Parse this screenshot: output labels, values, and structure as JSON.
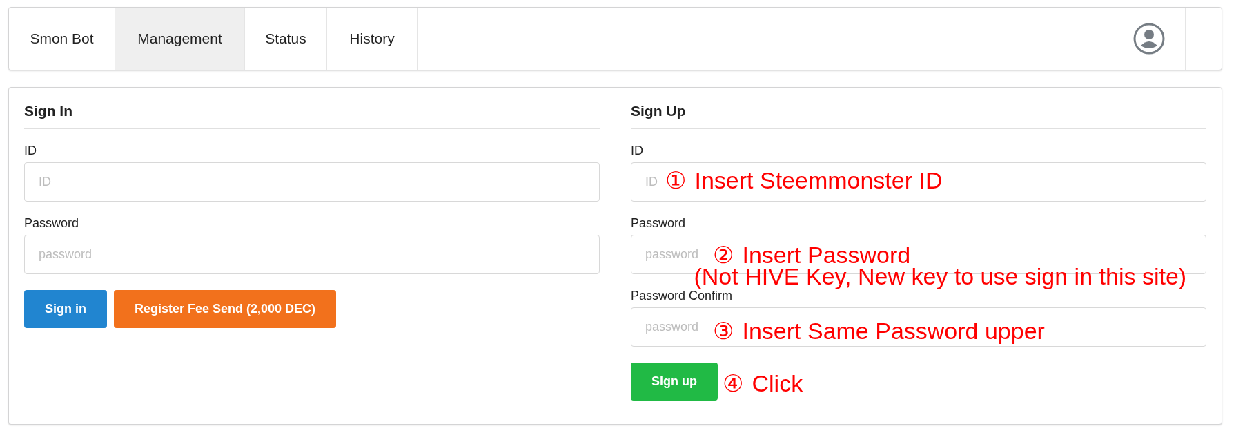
{
  "nav": {
    "tabs": [
      {
        "label": "Smon Bot",
        "selected": false
      },
      {
        "label": "Management",
        "selected": true
      },
      {
        "label": "Status",
        "selected": false
      },
      {
        "label": "History",
        "selected": false
      }
    ]
  },
  "sign_in": {
    "title": "Sign In",
    "fields": [
      {
        "label": "ID",
        "placeholder": "ID"
      },
      {
        "label": "Password",
        "placeholder": "password"
      }
    ],
    "buttons": [
      {
        "label": "Sign in",
        "kind": "primary"
      },
      {
        "label": "Register Fee Send (2,000 DEC)",
        "kind": "warning"
      }
    ]
  },
  "sign_up": {
    "title": "Sign Up",
    "fields": [
      {
        "label": "ID",
        "placeholder": "ID"
      },
      {
        "label": "Password",
        "placeholder": "password"
      },
      {
        "label": "Password Confirm",
        "placeholder": "password"
      }
    ],
    "buttons": [
      {
        "label": "Sign up",
        "kind": "success"
      }
    ]
  },
  "annotations": [
    {
      "marker": "①",
      "lines": [
        "Insert Steemmonster ID"
      ]
    },
    {
      "marker": "②",
      "lines": [
        "Insert Password",
        "(Not HIVE Key, New key to use sign in this site)"
      ]
    },
    {
      "marker": "③",
      "lines": [
        "Insert Same Password upper"
      ]
    },
    {
      "marker": "④",
      "lines": [
        "Click"
      ]
    }
  ]
}
